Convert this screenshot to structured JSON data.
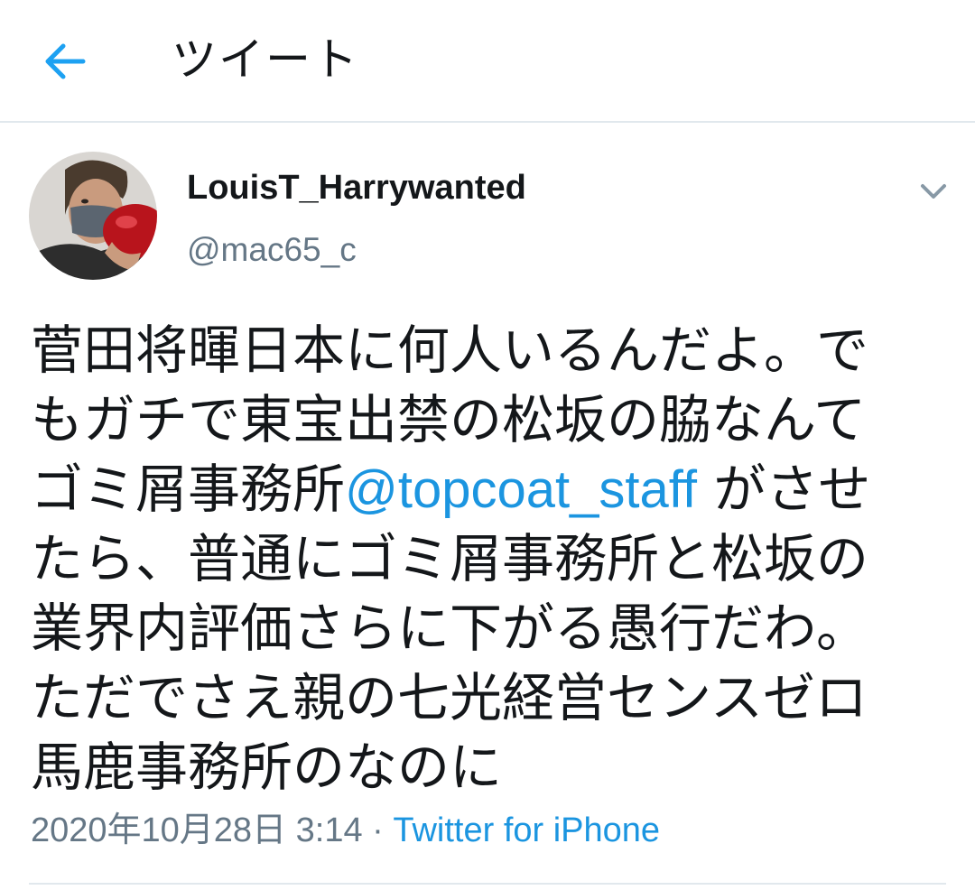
{
  "header": {
    "title": "ツイート",
    "back_icon": "back-arrow-icon",
    "accent_color": "#1da1f2"
  },
  "tweet": {
    "display_name": "LouisT_Harrywanted",
    "handle": "@mac65_c",
    "caret_icon": "chevron-down-icon",
    "text_lines": [
      "菅田将暉日本に何人いるんだよ。で",
      "もガチで東宝出禁の松坂の脇なんて",
      "ゴミ屑事務所",
      "たら、普通にゴミ屑事務所と松坂の",
      "業界内評価さらに下がる愚行だわ。",
      "ただでさえ親の七光経営センスゼロ",
      "馬鹿事務所のなのに"
    ],
    "mention": "@topcoat_staff",
    "after_mention": " がさせ",
    "timestamp": "2020年10月28日 3:14",
    "separator": " · ",
    "source": "Twitter for iPhone",
    "link_color": "#1b95e0",
    "secondary_text_color": "#657786"
  }
}
